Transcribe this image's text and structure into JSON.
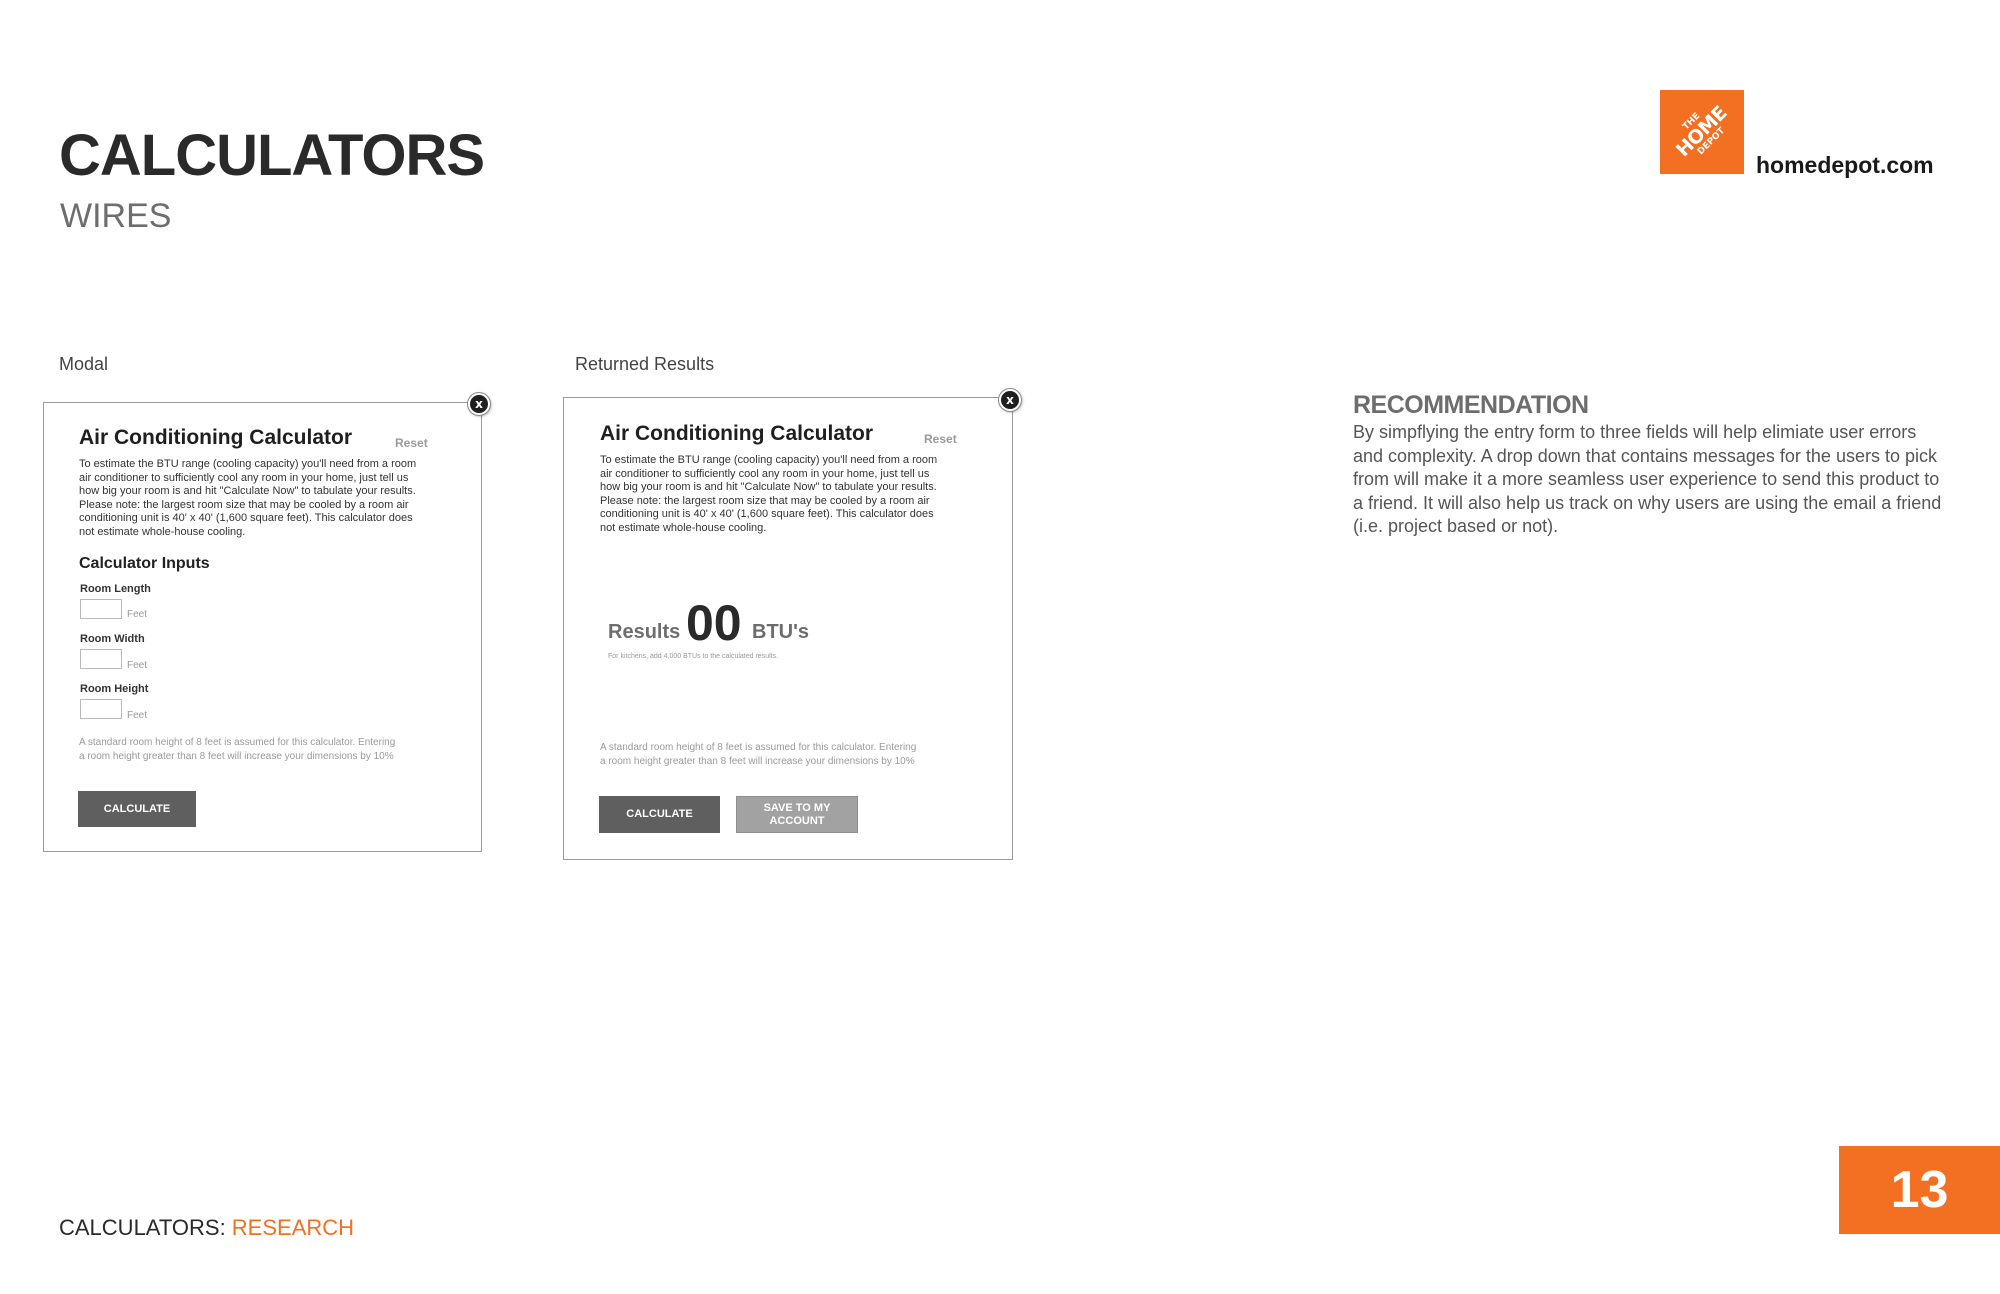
{
  "header": {
    "title": "CALCULATORS",
    "subtitle": "WIRES"
  },
  "logo": {
    "mark_line1": "THE",
    "mark_line2": "HOME",
    "mark_line3": "DEPOT",
    "domain": "homedepot.com",
    "brand_color": "#f36f21"
  },
  "columns": {
    "modal_caption": "Modal",
    "results_caption": "Returned Results"
  },
  "modal": {
    "close_label": "x",
    "title": "Air Conditioning Calculator",
    "reset_label": "Reset",
    "description_lines": [
      "To estimate the BTU range (cooling capacity) you'll need from a room",
      "air conditioner to sufficiently cool any room in your home, just tell us",
      "how big your room is and hit \"Calculate Now\" to tabulate your results.",
      "Please note: the largest room size that may be cooled by a room air",
      "conditioning unit is 40' x 40' (1,600 square feet). This calculator does",
      "not estimate whole-house cooling."
    ],
    "inputs_heading": "Calculator Inputs",
    "fields": [
      {
        "label": "Room Length",
        "unit": "Feet",
        "value": ""
      },
      {
        "label": "Room Width",
        "unit": "Feet",
        "value": ""
      },
      {
        "label": "Room Height",
        "unit": "Feet",
        "value": ""
      }
    ],
    "note_lines": [
      "A standard room height of 8 feet is assumed for this calculator. Entering",
      "a room height greater than 8 feet will increase your dimensions by 10%"
    ],
    "calculate_label": "CALCULATE"
  },
  "results_modal": {
    "close_label": "x",
    "title": "Air Conditioning Calculator",
    "reset_label": "Reset",
    "description_lines": [
      "To estimate the BTU range (cooling capacity) you'll need from a room",
      "air conditioner to sufficiently cool any room in your home, just tell us",
      "how big your room is and hit \"Calculate Now\" to tabulate your results.",
      "Please note: the largest room size that may be cooled by a room air",
      "conditioning unit is 40' x 40' (1,600 square feet). This calculator does",
      "not estimate whole-house cooling."
    ],
    "results_label": "Results",
    "results_value": "00",
    "results_unit": "BTU's",
    "results_note": "For kitchens, add 4,000 BTUs to the calculated results.",
    "note_lines": [
      "A standard room height of 8 feet is assumed for this calculator. Entering",
      "a room height greater than 8 feet will increase your dimensions by 10%"
    ],
    "calculate_label": "CALCULATE",
    "save_label_line1": "SAVE TO MY",
    "save_label_line2": "ACCOUNT"
  },
  "recommendation": {
    "heading": "RECOMMENDATION",
    "body": "By simpflying the entry form to three fields will help elimiate user errors and complexity. A drop down that contains messages for the users to pick from will make it a more seamless user experience to send this product to a friend. It will also help us track on why users are using the email a friend (i.e. project based or not)."
  },
  "footer": {
    "section": "CALCULATORS: ",
    "subsection": "RESEARCH",
    "page_number": "13"
  }
}
